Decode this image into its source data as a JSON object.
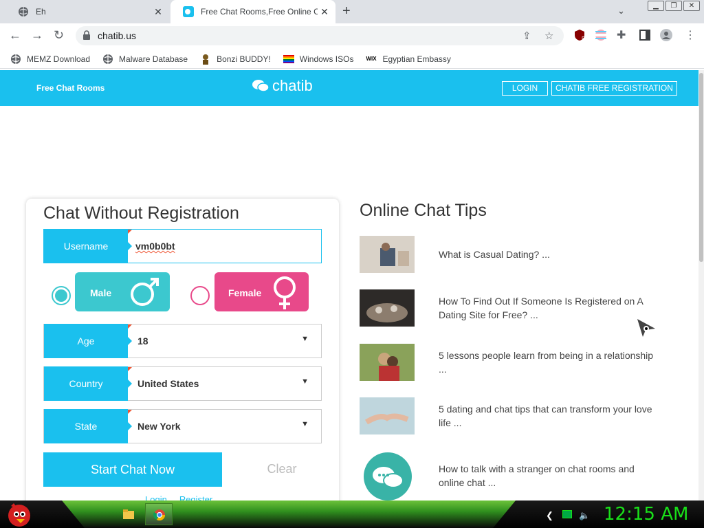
{
  "browser": {
    "tabs": [
      {
        "title": "Eh",
        "close": "✕"
      },
      {
        "title": "Free Chat Rooms,Free Online Ch",
        "close": "✕"
      }
    ],
    "new_tab": "+",
    "url": "chatib.us",
    "extension_badge": "5",
    "bookmarks": [
      {
        "label": "MEMZ Download",
        "icon": "globe-icon"
      },
      {
        "label": "Malware Database",
        "icon": "globe-icon"
      },
      {
        "label": "Bonzi BUDDY!",
        "icon": "bonzi-icon"
      },
      {
        "label": "Windows ISOs",
        "icon": "rainbow-flag-icon"
      },
      {
        "label": "Egyptian Embassy",
        "icon": "wix-icon"
      }
    ]
  },
  "site": {
    "brand": "Free Chat Rooms",
    "logo_text": "chatib",
    "login": "LOGIN",
    "register": "CHATIB FREE REGISTRATION"
  },
  "form": {
    "title": "Chat Without Registration",
    "username_label": "Username",
    "username_value": "vm0b0bt",
    "male": "Male",
    "female": "Female",
    "age_label": "Age",
    "age_value": "18",
    "country_label": "Country",
    "country_value": "United States",
    "state_label": "State",
    "state_value": "New York",
    "start": "Start Chat Now",
    "clear": "Clear",
    "login_link": "Login",
    "register_link": "Register"
  },
  "tips": {
    "title": "Online Chat Tips",
    "items": [
      {
        "text": "What is Casual Dating? ..."
      },
      {
        "text": "How To Find Out If Someone Is Registered on A Dating Site for Free? ..."
      },
      {
        "text": "5 lessons people learn from being in a relationship ..."
      },
      {
        "text": "5 dating and chat tips that can transform your love life ..."
      },
      {
        "text": "How to talk with a stranger on chat rooms and online chat ..."
      }
    ]
  },
  "taskbar": {
    "clock": "12:15 AM"
  },
  "colors": {
    "accent": "#1ac0ee",
    "male": "#3cc8cf",
    "female": "#e8498a",
    "clock": "#19e019"
  }
}
